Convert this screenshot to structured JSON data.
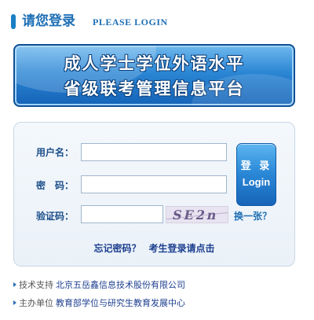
{
  "header": {
    "title": "请您登录",
    "subtitle": "PLEASE LOGIN"
  },
  "banner": {
    "line1": "成人学士学位外语水平",
    "line2": "省级联考管理信息平台"
  },
  "form": {
    "username_label": "用户名：",
    "username_value": "",
    "password_label": "密　码：",
    "password_value": "",
    "captcha_label": "验证码：",
    "captcha_value": "",
    "captcha_text": "SE2n",
    "change_captcha": "换一张？",
    "login_button_cn": "登 录",
    "login_button_en": "Login",
    "forgot_password": "忘记密码？",
    "student_login": "考生登录请点击"
  },
  "footer": {
    "support_label": "技术支持",
    "support_value": "北京五岳鑫信息技术股份有限公司",
    "host_label": "主办单位",
    "host_value": "教育部学位与研究生教育发展中心"
  },
  "colors": {
    "accent": "#1e6fb5",
    "link": "#1d3f8f",
    "panel_border": "#c9d8e6"
  }
}
